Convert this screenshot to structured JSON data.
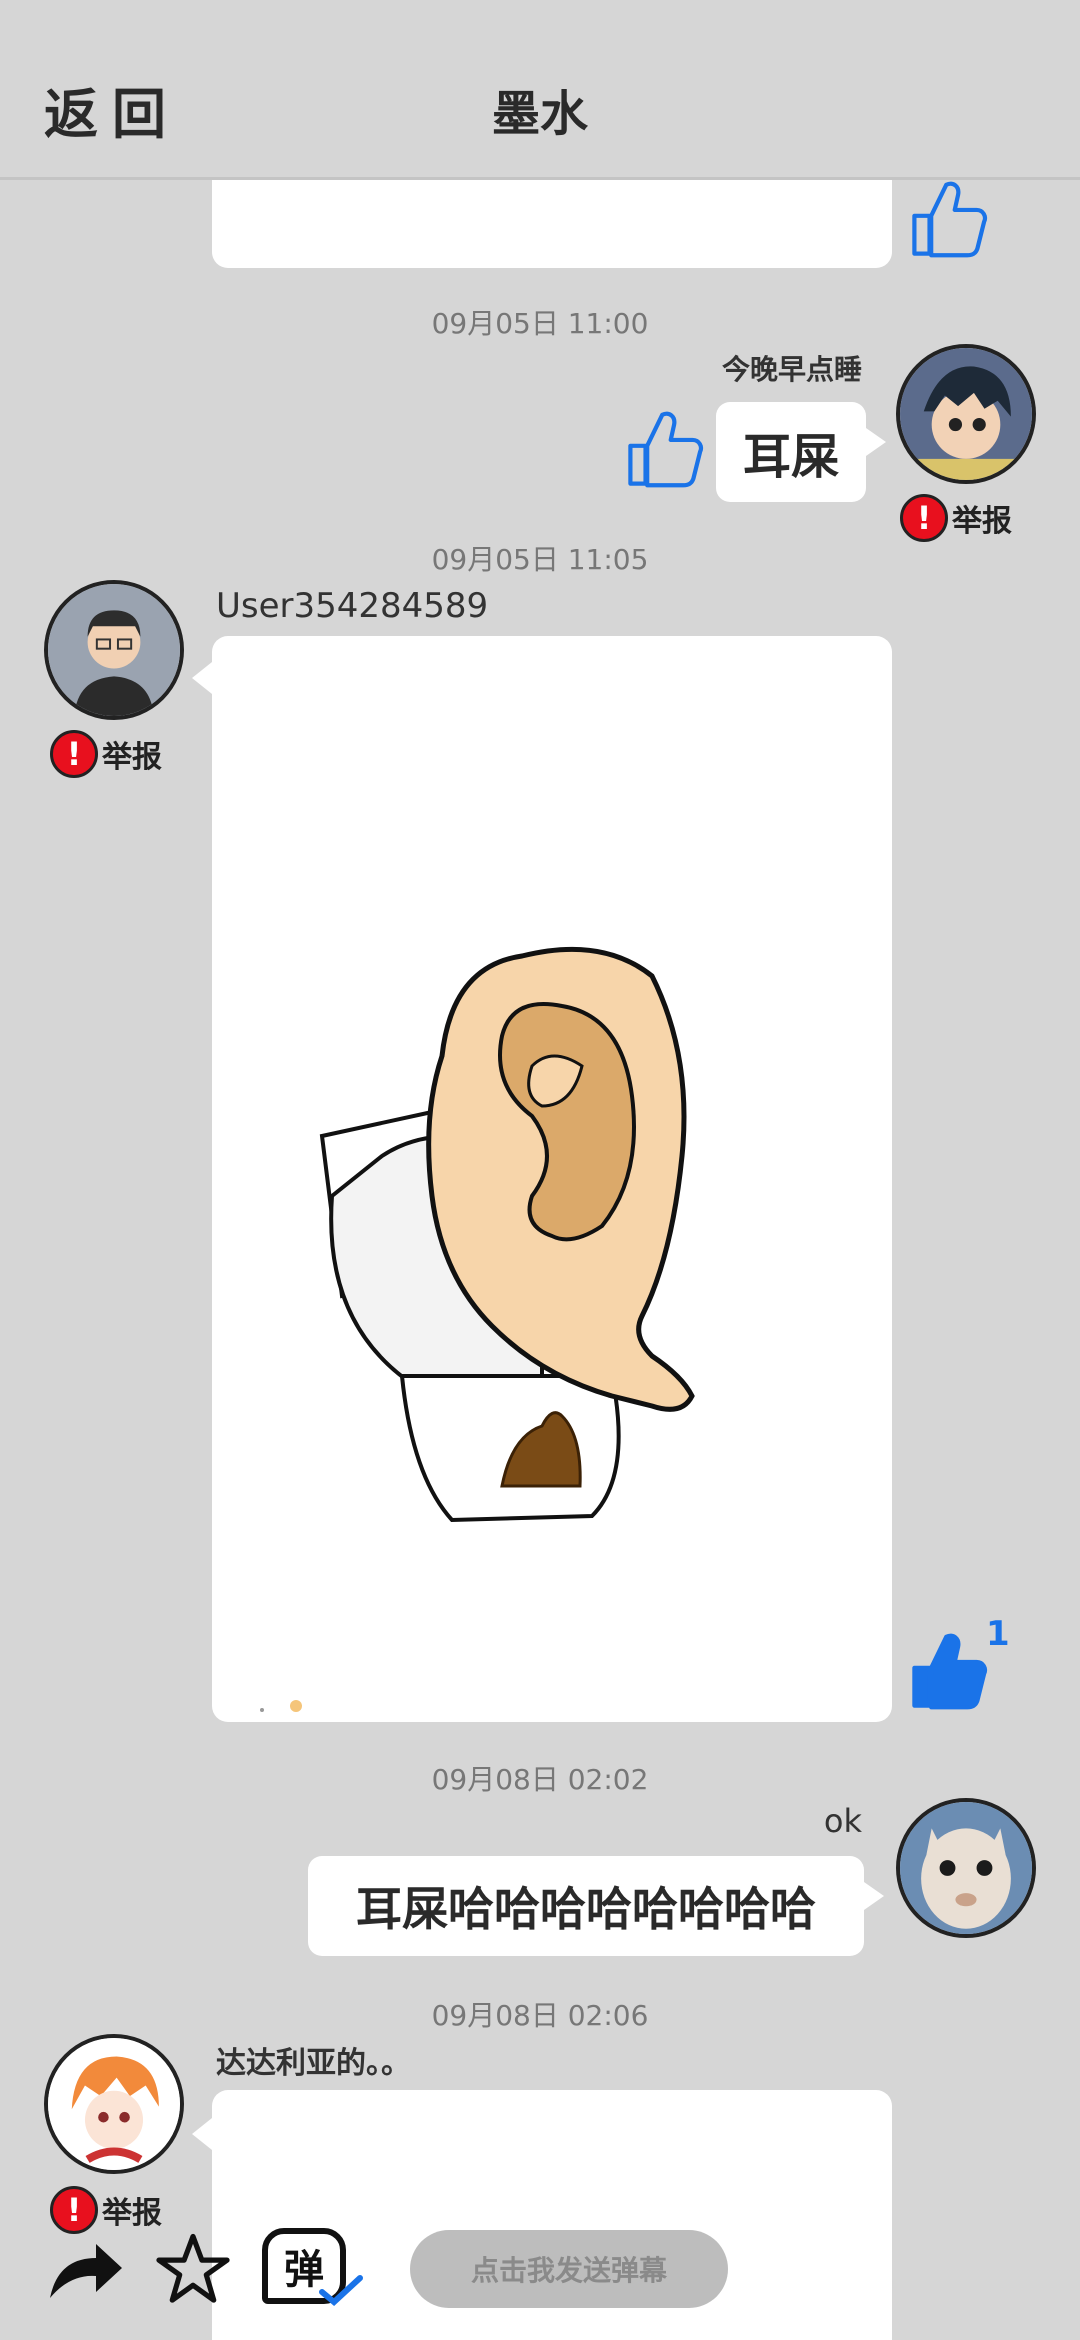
{
  "header": {
    "back_label": "返回",
    "title": "墨水"
  },
  "messages": [
    {
      "timestamp": "09月05日 11:00",
      "author": "今晚早点睡",
      "text": "耳屎",
      "report_label": "举报"
    },
    {
      "timestamp": "09月05日 11:05",
      "author": "User354284589",
      "report_label": "举报",
      "like_count": "1"
    },
    {
      "timestamp": "09月08日 02:02",
      "author": "ok",
      "text": "耳屎哈哈哈哈哈哈哈哈"
    },
    {
      "timestamp": "09月08日 02:06",
      "author": "达达利亚的。。",
      "report_label": "举报"
    }
  ],
  "bottom_bar": {
    "danmu_icon_label": "弹",
    "danmu_placeholder": "点击我发送弹幕"
  },
  "icons": {
    "like": "thumbs-up-icon",
    "report": "exclamation-icon",
    "share": "share-arrow-icon",
    "favorite": "star-icon",
    "danmu": "danmu-icon"
  },
  "colors": {
    "like_blue": "#1a73e8",
    "report_red": "#e8101e",
    "background": "#d6d6d6"
  }
}
